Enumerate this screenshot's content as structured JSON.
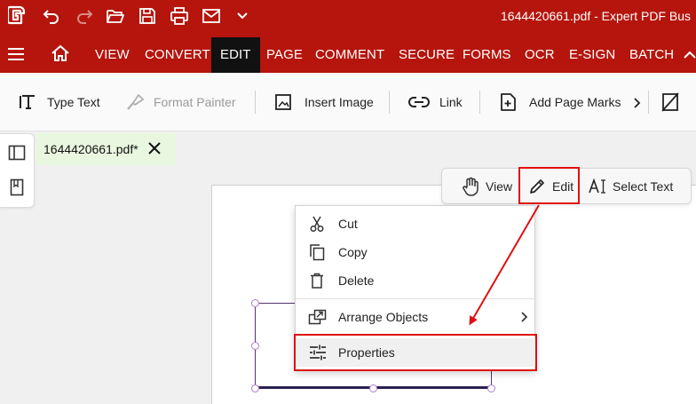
{
  "window": {
    "title": "1644420661.pdf  -  Expert PDF Bus"
  },
  "quick_access": [
    {
      "icon": "app-logo-icon"
    },
    {
      "icon": "undo-icon"
    },
    {
      "icon": "redo-icon"
    },
    {
      "icon": "open-folder-icon"
    },
    {
      "icon": "save-icon"
    },
    {
      "icon": "print-icon"
    },
    {
      "icon": "email-icon"
    },
    {
      "icon": "chevron-down-icon"
    }
  ],
  "menu": {
    "items": [
      {
        "label": "VIEW"
      },
      {
        "label": "CONVERT"
      },
      {
        "label": "EDIT",
        "active": true
      },
      {
        "label": "PAGE"
      },
      {
        "label": "COMMENT"
      },
      {
        "label": "SECURE"
      },
      {
        "label": "FORMS"
      },
      {
        "label": "OCR"
      },
      {
        "label": "E-SIGN"
      },
      {
        "label": "BATCH"
      }
    ]
  },
  "ribbon": {
    "type_text": "Type Text",
    "format_painter": "Format Painter",
    "insert_image": "Insert Image",
    "link": "Link",
    "add_page_marks": "Add Page Marks"
  },
  "tab": {
    "label": "1644420661.pdf*"
  },
  "mode_bar": {
    "view": "View",
    "edit": "Edit",
    "select_text": "Select Text"
  },
  "context_menu": {
    "cut": "Cut",
    "copy": "Copy",
    "delete": "Delete",
    "arrange_objects": "Arrange Objects",
    "properties": "Properties"
  },
  "colors": {
    "brand_red": "#b5150d",
    "active_tab": "#111111",
    "highlight": "#e01010",
    "tab_bg": "#eaf7e0"
  }
}
